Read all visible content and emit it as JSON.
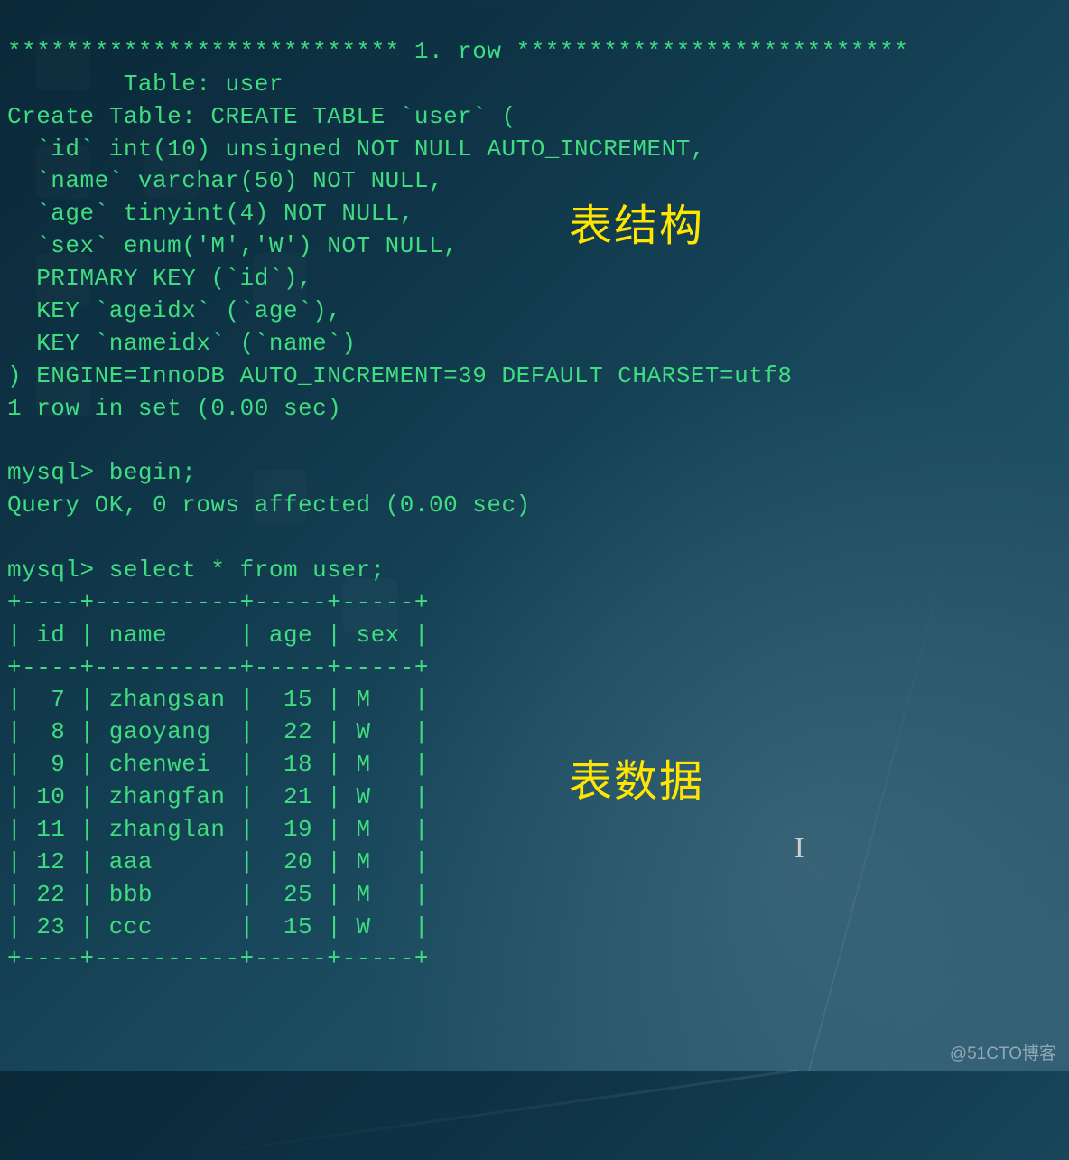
{
  "row_header": "*************************** 1. row ***************************",
  "schema": {
    "table_label": "        Table: user",
    "create_label": "Create Table: CREATE TABLE `user` (",
    "col_id": "  `id` int(10) unsigned NOT NULL AUTO_INCREMENT,",
    "col_name": "  `name` varchar(50) NOT NULL,",
    "col_age": "  `age` tinyint(4) NOT NULL,",
    "col_sex": "  `sex` enum('M','W') NOT NULL,",
    "pk": "  PRIMARY KEY (`id`),",
    "key_age": "  KEY `ageidx` (`age`),",
    "key_name": "  KEY `nameidx` (`name`)",
    "engine": ") ENGINE=InnoDB AUTO_INCREMENT=39 DEFAULT CHARSET=utf8",
    "result": "1 row in set (0.00 sec)"
  },
  "commands": {
    "begin_prompt": "mysql> begin;",
    "begin_result": "Query OK, 0 rows affected (0.00 sec)",
    "select_prompt": "mysql> select * from user;"
  },
  "table": {
    "border": "+----+----------+-----+-----+",
    "header": "| id | name     | age | sex |",
    "rows": [
      "|  7 | zhangsan |  15 | M   |",
      "|  8 | gaoyang  |  22 | W   |",
      "|  9 | chenwei  |  18 | M   |",
      "| 10 | zhangfan |  21 | W   |",
      "| 11 | zhanglan |  19 | M   |",
      "| 12 | aaa      |  20 | M   |",
      "| 22 | bbb      |  25 | M   |",
      "| 23 | ccc      |  15 | W   |"
    ]
  },
  "annotations": {
    "structure": "表结构",
    "data": "表数据"
  },
  "watermark": "@51CTO博客",
  "cursor": "I"
}
